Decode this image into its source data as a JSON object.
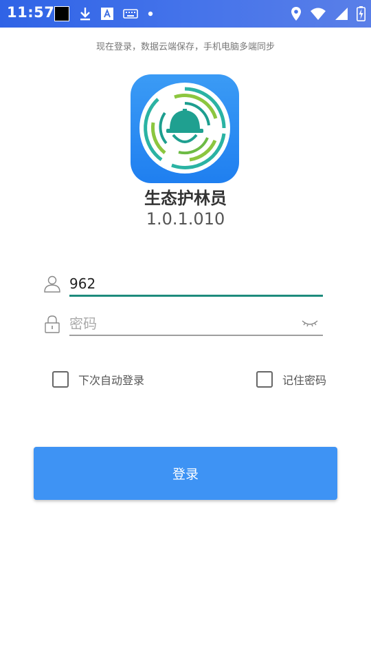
{
  "status_bar": {
    "time": "11:57",
    "left_icons": [
      "black-square-notification",
      "download-icon",
      "a-font-icon",
      "keyboard-icon",
      "dot-icon"
    ],
    "right_icons": [
      "location-icon",
      "wifi-icon",
      "signal-icon",
      "battery-charging-icon"
    ]
  },
  "header": {
    "tip": "现在登录，数据云端保存，手机电脑多端同步"
  },
  "app": {
    "name": "生态护林员",
    "version": "1.0.1.010",
    "logo_icon": "forest-ranger-helmet-logo-icon"
  },
  "form": {
    "username_value": "962",
    "password_placeholder": "密码",
    "auto_login_label": "下次自动登录",
    "remember_label": "记住密码",
    "login_label": "登录"
  },
  "colors": {
    "status_bar": "#3d6de0",
    "accent_underline": "#1d8b7c",
    "login_button": "#3e93f4"
  }
}
